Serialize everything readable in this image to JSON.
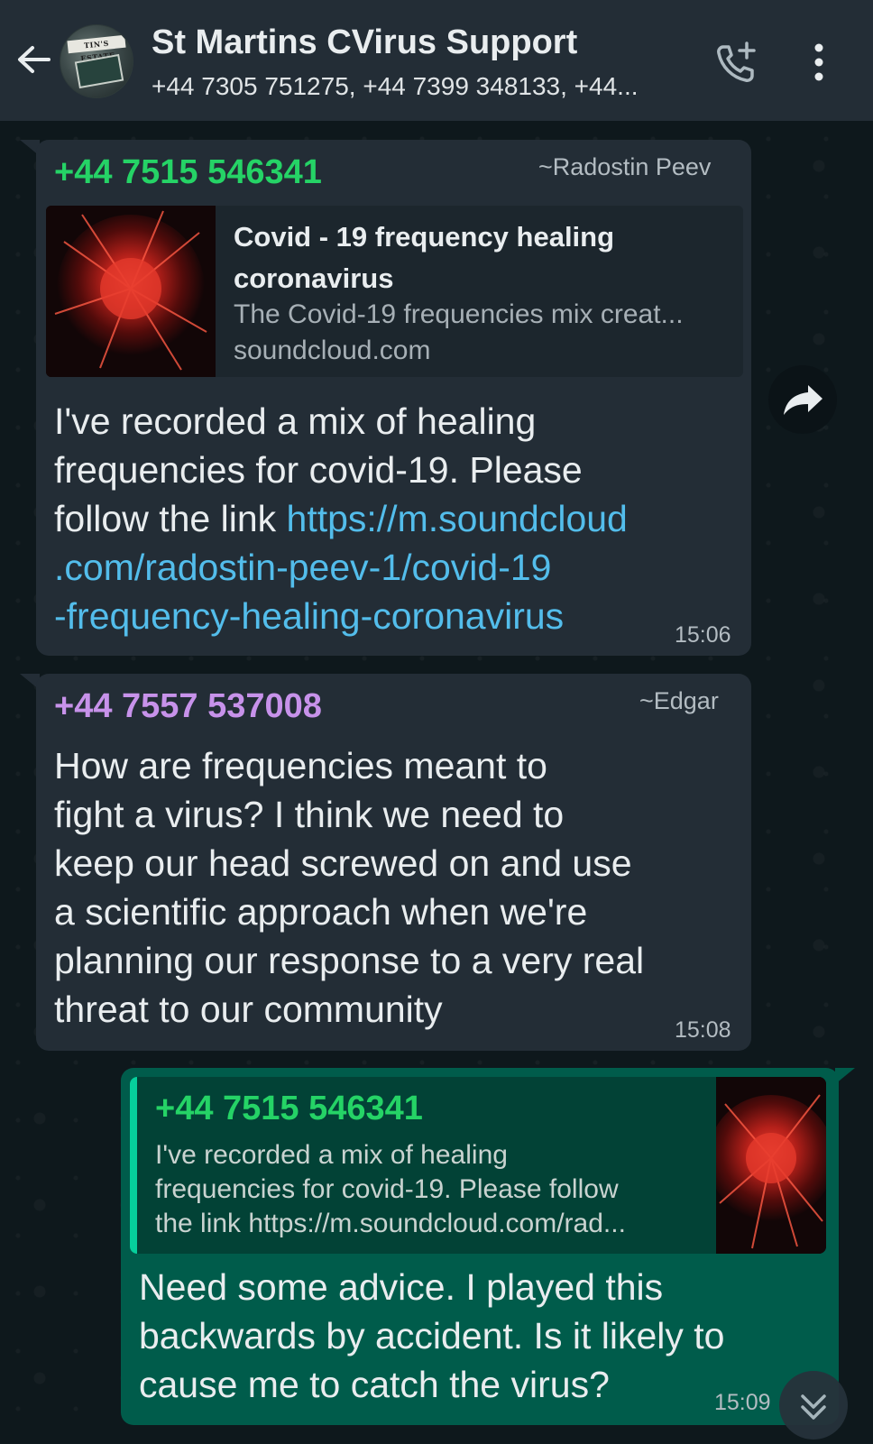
{
  "header": {
    "title": "St Martins CVirus Support",
    "participants": "+44 7305 751275, +44 7399 348133, +44...",
    "avatar_sign_text": "TIN'S ESTATE"
  },
  "messages": [
    {
      "sender": "+44 7515 546341",
      "pushname": "~Radostin Peev",
      "sender_color": "#25d366",
      "preview": {
        "title": "Covid - 19 frequency healing coronavirus",
        "title_line1": "Covid - 19 frequency healing",
        "title_line2": "coronavirus",
        "description": "The Covid-19 frequencies mix creat...",
        "domain": "soundcloud.com"
      },
      "text_line1": "I've recorded a mix of healing",
      "text_line2": "frequencies for covid-19. Please",
      "text_line3_plain": "follow the link ",
      "link_part1": "https://m.soundcloud",
      "link_part2": ".com/radostin-peev-1/covid-19",
      "link_part3": "-frequency-healing-coronavirus",
      "time": "15:06"
    },
    {
      "sender": "+44 7557 537008",
      "pushname": "~Edgar",
      "sender_color": "#c792ea",
      "text_lines": [
        "How are frequencies meant to",
        "fight a virus? I think we need to",
        "keep our head screwed on and use",
        "a scientific approach when we're",
        "planning our response to a very real",
        "threat to our community"
      ],
      "time": "15:08"
    },
    {
      "quoted": {
        "sender": "+44 7515 546341",
        "text_lines": [
          "I've recorded a mix of healing",
          "frequencies for covid-19. Please follow",
          "the link https://m.soundcloud.com/rad..."
        ]
      },
      "text_lines": [
        "Need some advice. I played this",
        "backwards by accident. Is it likely to",
        "cause me to catch the virus?"
      ],
      "time": "15:09"
    }
  ],
  "icons": {
    "back": "arrow-left-icon",
    "call_add": "phone-plus-icon",
    "menu": "more-vertical-icon",
    "forward": "forward-icon",
    "scroll": "double-chevron-down-icon"
  }
}
